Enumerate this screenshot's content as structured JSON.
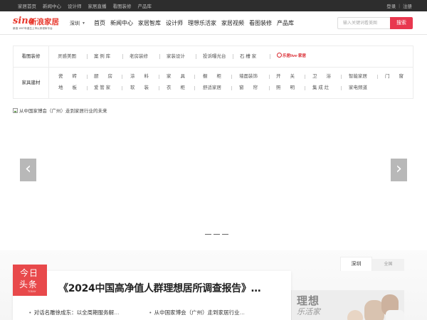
{
  "topbar": {
    "links": [
      "家居首页",
      "新闻中心",
      "设计师",
      "家居直播",
      "看图装修",
      "产品库"
    ],
    "login": "登录",
    "separator": "|",
    "register": "注册"
  },
  "header": {
    "logo": {
      "sina": "sina",
      "cn": "新浪家居",
      "tagline": "新浪 1997年诞生上市以来领军平台"
    },
    "city": "深圳",
    "nav": [
      "首页",
      "新闻中心",
      "家居智库",
      "设计师",
      "理想乐活家",
      "家居视频",
      "看图装修",
      "产品库"
    ],
    "search": {
      "placeholder": "输入关键词看美图",
      "button": "搜索"
    }
  },
  "categories": {
    "row1": {
      "label": "看图装修",
      "items": [
        "灵感美图",
        "案 例 库",
        "老房装修",
        "家装设计",
        "投诉曝光台",
        "石 槽 家"
      ],
      "brand": "乐居live·家居"
    },
    "row2": {
      "label": "家具建材",
      "line1": [
        "瓷　　砖",
        "厨　　房",
        "涂　　料",
        "家　　具",
        "橱　　柜",
        "墙面装饰",
        "开　　关",
        "卫　　浴",
        "智能家居",
        "门　　窗"
      ],
      "line2": [
        "地　　板",
        "爱 管 家",
        "软　　装",
        "衣　　柜",
        "舒适家居",
        "窗　　帘",
        "照　　明",
        "集 成 灶",
        "家电频道"
      ]
    }
  },
  "banner": {
    "alt": "从中国家博会（广州）走到家居行业的未来",
    "prev": "‹",
    "next": "›",
    "slides": 3
  },
  "news": {
    "tag": {
      "line1": "今日",
      "line2": "头条",
      "sub": "TODAY"
    },
    "headline": "《2024中国高净值人群理想居所调查报告》…",
    "items": [
      {
        "bullet": "•",
        "text": "对话名雕徐成东：以全周期服务解…"
      },
      {
        "bullet": "•",
        "text": "从中国家博会（广州）走到家居行业…"
      }
    ]
  },
  "side": {
    "tabs": [
      "深圳",
      "全国"
    ],
    "promo": {
      "line1": "理想",
      "line2": "乐活家"
    }
  }
}
